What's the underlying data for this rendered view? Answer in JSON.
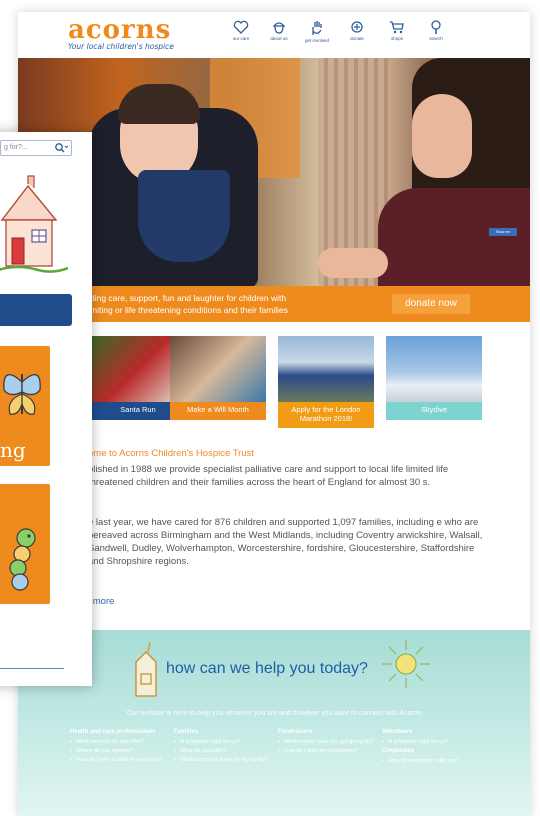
{
  "brand": {
    "logo_text": "acorns",
    "tagline": "Your local children's hospice"
  },
  "nav": [
    {
      "label": "our care",
      "icon": "heart-icon"
    },
    {
      "label": "about us",
      "icon": "acorn-icon"
    },
    {
      "label": "get involved",
      "icon": "hand-icon"
    },
    {
      "label": "donate",
      "icon": "donate-icon"
    },
    {
      "label": "shops",
      "icon": "cart-icon"
    },
    {
      "label": "search",
      "icon": "search-icon"
    }
  ],
  "hero": {
    "corner_button": "Show me"
  },
  "banner": {
    "line1": "ding care, support, fun and laughter for children with",
    "line2": "miting or life threatening conditions and their families",
    "donate_label": "donate now"
  },
  "tiles": [
    {
      "caption": "Santa Run"
    },
    {
      "caption": "Make a Will Month"
    },
    {
      "caption": "Apply for the London Marathon 2018!"
    },
    {
      "caption": "Skydive"
    }
  ],
  "content": {
    "welcome": "ome to Acorns Children's Hospice Trust",
    "p1": "blished in 1988 we provide specialist palliative care and support to local life limited life threatened children and their families across the heart of England for almost 30 s.",
    "p2": "e last year, we have cared for 876 children and supported 1,097 families, including e who are bereaved across Birmingham and the West Midlands, including Coventry arwickshire, Walsall, Sandwell, Dudley, Wolverhampton, Worcestershire, fordshire, Gloucestershire, Staffordshire and Shropshire regions.",
    "read_more": "l more"
  },
  "help": {
    "title": "how can we help you today?",
    "subtitle": "Our website is here to help you whoever you are and however you want to connect with Acorns",
    "columns": [
      {
        "heading": "Health and care professionals",
        "items": [
          "What services do you offer?",
          "Where do you operate?",
          "How do I refer a child to your care?"
        ]
      },
      {
        "heading": "Families",
        "items": [
          "Is a hospice right for us?",
          "What do you offer?",
          "What support is there for my family?"
        ]
      },
      {
        "heading": "Fundraisers",
        "items": [
          "What events have you got going on?",
          "How do I start my fundraising?"
        ]
      },
      {
        "heading": "Volunteers",
        "items": [
          "Is a hospice right for us?"
        ],
        "heading2": "Corporates",
        "items2": [
          "How do we partner with you?"
        ]
      }
    ]
  },
  "mobile": {
    "search_placeholder": "g for?...",
    "tile_text": "ng"
  },
  "colors": {
    "brand_orange": "#ef8b1e",
    "brand_blue": "#1f4d8c",
    "help_teal": "#a7dcd6",
    "link_blue": "#2c6cb0"
  }
}
